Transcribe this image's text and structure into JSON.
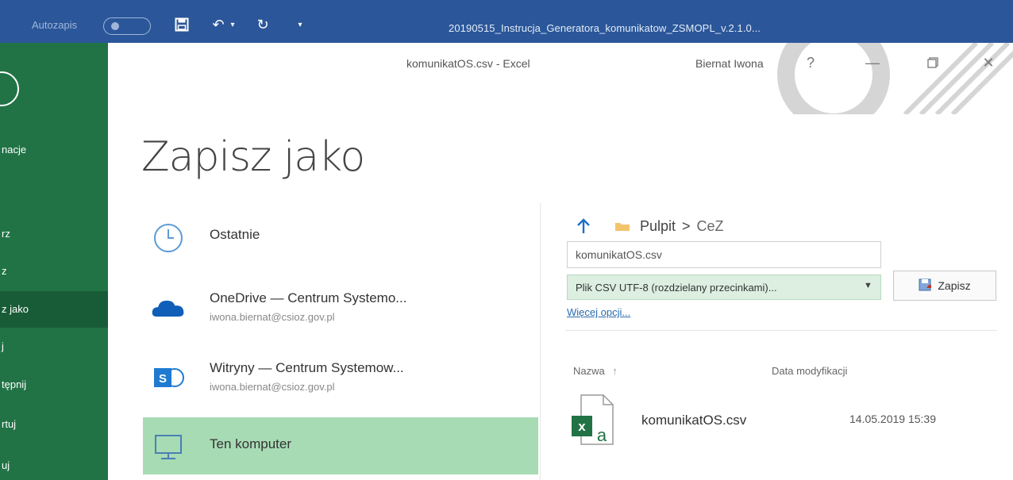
{
  "titlebar": {
    "autosave_label": "Autozapis",
    "document_title": "20190515_Instrucja_Generatora_komunikatow_ZSMOPL_v.2.1.0..."
  },
  "window": {
    "title": "komunikatOS.csv - Excel",
    "user": "Biernat Iwona",
    "help": "?",
    "minimize": "—",
    "close": "✕"
  },
  "nav": {
    "items": [
      {
        "label": "nacje"
      },
      {
        "label": "rz"
      },
      {
        "label": "z"
      },
      {
        "label": "z jako"
      },
      {
        "label": "j"
      },
      {
        "label": "tępnij"
      },
      {
        "label": "rtuj"
      },
      {
        "label": "uj"
      }
    ]
  },
  "page": {
    "title": "Zapisz jako"
  },
  "places": [
    {
      "name": "Ostatnie",
      "sub": ""
    },
    {
      "name": "OneDrive — Centrum Systemo...",
      "sub": "iwona.biernat@csioz.gov.pl"
    },
    {
      "name": "Witryny — Centrum Systemow...",
      "sub": "iwona.biernat@csioz.gov.pl"
    },
    {
      "name": "Ten komputer",
      "sub": ""
    }
  ],
  "save_pane": {
    "breadcrumb": [
      "Pulpit",
      "CeZ"
    ],
    "separator": ">",
    "filename": "komunikatOS.csv",
    "filetype": "Plik CSV UTF-8 (rozdzielany przecinkami)...",
    "save_label": "Zapisz",
    "more_options": "Więcej opcji...",
    "col_name": "Nazwa",
    "col_sort": "↑",
    "col_date": "Data modyfikacji",
    "files": [
      {
        "name": "komunikatOS.csv",
        "modified": "14.05.2019 15:39"
      }
    ]
  },
  "colors": {
    "titlebar": "#2b579a",
    "nav": "#217346",
    "nav_active": "#185c37",
    "place_active": "#a7dbb4",
    "filetype_bg": "#dcefe0"
  }
}
